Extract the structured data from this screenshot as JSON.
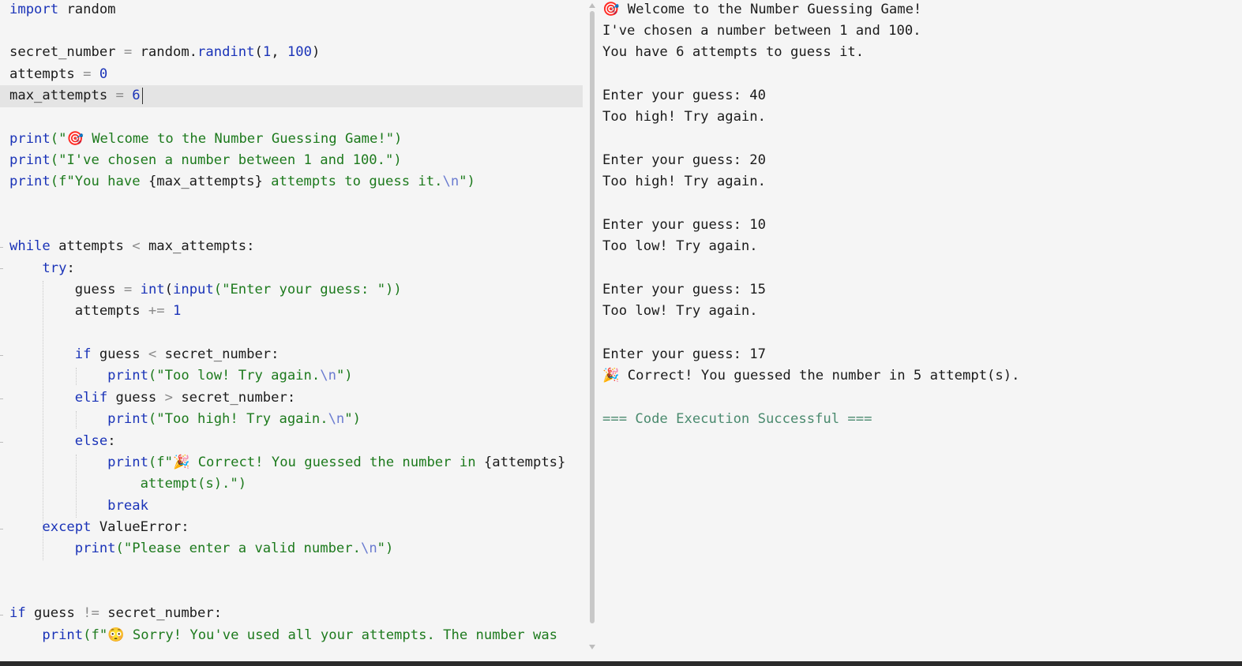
{
  "editor": {
    "lines": [
      [
        {
          "t": "import",
          "c": "kw"
        },
        {
          "t": " random",
          "c": "pl"
        }
      ],
      [],
      [
        {
          "t": "secret_number ",
          "c": "pl"
        },
        {
          "t": "=",
          "c": "op"
        },
        {
          "t": " random.",
          "c": "pl"
        },
        {
          "t": "randint",
          "c": "fn"
        },
        {
          "t": "(",
          "c": "pl"
        },
        {
          "t": "1",
          "c": "nm"
        },
        {
          "t": ", ",
          "c": "pl"
        },
        {
          "t": "100",
          "c": "nm"
        },
        {
          "t": ")",
          "c": "pl"
        }
      ],
      [
        {
          "t": "attempts ",
          "c": "pl"
        },
        {
          "t": "=",
          "c": "op"
        },
        {
          "t": " ",
          "c": "pl"
        },
        {
          "t": "0",
          "c": "nm"
        }
      ],
      [
        {
          "t": "max_attempts ",
          "c": "pl"
        },
        {
          "t": "=",
          "c": "op"
        },
        {
          "t": " ",
          "c": "pl"
        },
        {
          "t": "6",
          "c": "nm"
        }
      ],
      [],
      [
        {
          "t": "print",
          "c": "fn"
        },
        {
          "t": "(\"🎯 Welcome to the Number Guessing Game!\")",
          "c": "st"
        }
      ],
      [
        {
          "t": "print",
          "c": "fn"
        },
        {
          "t": "(\"I've chosen a number between 1 and 100.\")",
          "c": "st"
        }
      ],
      [
        {
          "t": "print",
          "c": "fn"
        },
        {
          "t": "(f\"You have ",
          "c": "st"
        },
        {
          "t": "{max_attempts}",
          "c": "pl"
        },
        {
          "t": " attempts to guess it.",
          "c": "st"
        },
        {
          "t": "\\n",
          "c": "es"
        },
        {
          "t": "\")",
          "c": "st"
        }
      ],
      [],
      [],
      [
        {
          "t": "while",
          "c": "kw"
        },
        {
          "t": " attempts ",
          "c": "pl"
        },
        {
          "t": "<",
          "c": "op"
        },
        {
          "t": " max_attempts:",
          "c": "pl"
        }
      ],
      [
        {
          "t": "    try",
          "c": "kw"
        },
        {
          "t": ":",
          "c": "pl"
        }
      ],
      [
        {
          "t": "        guess ",
          "c": "pl"
        },
        {
          "t": "=",
          "c": "op"
        },
        {
          "t": " ",
          "c": "pl"
        },
        {
          "t": "int",
          "c": "fn"
        },
        {
          "t": "(",
          "c": "pl"
        },
        {
          "t": "input",
          "c": "fn"
        },
        {
          "t": "(\"Enter your guess: \"))",
          "c": "st"
        }
      ],
      [
        {
          "t": "        attempts ",
          "c": "pl"
        },
        {
          "t": "+=",
          "c": "op"
        },
        {
          "t": " ",
          "c": "pl"
        },
        {
          "t": "1",
          "c": "nm"
        }
      ],
      [],
      [
        {
          "t": "        if",
          "c": "kw"
        },
        {
          "t": " guess ",
          "c": "pl"
        },
        {
          "t": "<",
          "c": "op"
        },
        {
          "t": " secret_number:",
          "c": "pl"
        }
      ],
      [
        {
          "t": "            print",
          "c": "fn"
        },
        {
          "t": "(\"Too low! Try again.",
          "c": "st"
        },
        {
          "t": "\\n",
          "c": "es"
        },
        {
          "t": "\")",
          "c": "st"
        }
      ],
      [
        {
          "t": "        elif",
          "c": "kw"
        },
        {
          "t": " guess ",
          "c": "pl"
        },
        {
          "t": ">",
          "c": "op"
        },
        {
          "t": " secret_number:",
          "c": "pl"
        }
      ],
      [
        {
          "t": "            print",
          "c": "fn"
        },
        {
          "t": "(\"Too high! Try again.",
          "c": "st"
        },
        {
          "t": "\\n",
          "c": "es"
        },
        {
          "t": "\")",
          "c": "st"
        }
      ],
      [
        {
          "t": "        else",
          "c": "kw"
        },
        {
          "t": ":",
          "c": "pl"
        }
      ],
      [
        {
          "t": "            print",
          "c": "fn"
        },
        {
          "t": "(f\"🎉 Correct! You guessed the number in ",
          "c": "st"
        },
        {
          "t": "{attempts}",
          "c": "pl"
        }
      ],
      [
        {
          "t": "                attempt(s).\")",
          "c": "st"
        }
      ],
      [
        {
          "t": "            break",
          "c": "kw"
        }
      ],
      [
        {
          "t": "    except",
          "c": "kw"
        },
        {
          "t": " ValueError:",
          "c": "pl"
        }
      ],
      [
        {
          "t": "        print",
          "c": "fn"
        },
        {
          "t": "(\"Please enter a valid number.",
          "c": "st"
        },
        {
          "t": "\\n",
          "c": "es"
        },
        {
          "t": "\")",
          "c": "st"
        }
      ],
      [],
      [],
      [
        {
          "t": "if",
          "c": "kw"
        },
        {
          "t": " guess ",
          "c": "pl"
        },
        {
          "t": "!=",
          "c": "op"
        },
        {
          "t": " secret_number:",
          "c": "pl"
        }
      ],
      [
        {
          "t": "    print",
          "c": "fn"
        },
        {
          "t": "(f\"😳 Sorry! You've used all your attempts. The number was",
          "c": "st"
        }
      ]
    ]
  },
  "output": {
    "lines": [
      "🎯 Welcome to the Number Guessing Game!",
      "I've chosen a number between 1 and 100.",
      "You have 6 attempts to guess it.",
      "",
      "Enter your guess: 40",
      "Too high! Try again.",
      "",
      "Enter your guess: 20",
      "Too high! Try again.",
      "",
      "Enter your guess: 10",
      "Too low! Try again.",
      "",
      "Enter your guess: 15",
      "Too low! Try again.",
      "",
      "Enter your guess: 17",
      "🎉 Correct! You guessed the number in 5 attempt(s).",
      "",
      "=== Code Execution Successful ==="
    ],
    "status": "=== Code Execution Successful ==="
  }
}
